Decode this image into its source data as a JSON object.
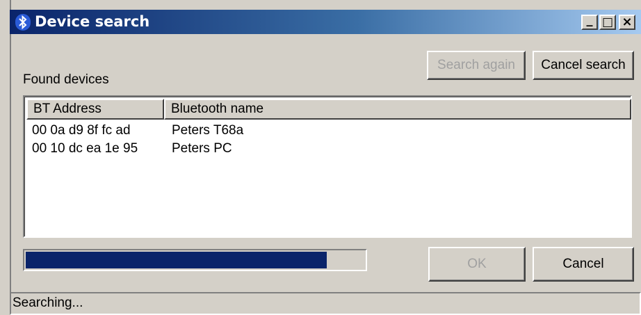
{
  "window": {
    "title": "Device search",
    "minimize_glyph": "_",
    "maximize_glyph": "□",
    "close_glyph": "×"
  },
  "buttons": {
    "search_again": "Search again",
    "cancel_search": "Cancel search",
    "ok": "OK",
    "cancel": "Cancel"
  },
  "found_devices_label": "Found devices",
  "table": {
    "columns": [
      "BT Address",
      "Bluetooth name"
    ],
    "rows": [
      {
        "address": "00 0a d9 8f fc ad",
        "name": "Peters T68a"
      },
      {
        "address": "00 10 dc ea 1e 95",
        "name": "Peters PC"
      }
    ]
  },
  "progress": {
    "value_fraction": 0.89
  },
  "status": "Searching...",
  "colors": {
    "titlebar_start": "#0a246a",
    "titlebar_end": "#a6caf0",
    "progress_fill": "#0a246a",
    "dialog_bg": "#d4d0c8"
  },
  "icons": {
    "app": "bluetooth-icon"
  }
}
